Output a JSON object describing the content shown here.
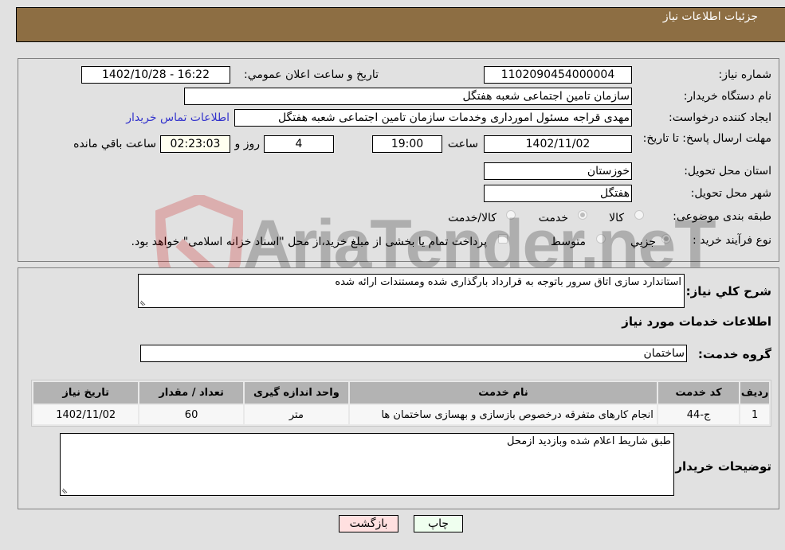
{
  "header": {
    "title": "جزئیات اطلاعات نیاز"
  },
  "form": {
    "need_number": {
      "label": "شماره نیاز:",
      "value": "1102090454000004"
    },
    "announce_datetime": {
      "label": "تاریخ و ساعت اعلان عمومي:",
      "value": "1402/10/28 - 16:22"
    },
    "buyer_org": {
      "label": "نام دستگاه خریدار:",
      "value": "سازمان تامین اجتماعی شعبه هفتگل"
    },
    "creator": {
      "label": "ایجاد کننده درخواست:",
      "value": "مهدی قراجه مسئول امورداری وخدمات سازمان تامین اجتماعی شعبه هفتگل"
    },
    "contact_link": "اطلاعات تماس خریدار",
    "deadline": {
      "label": "مهلت ارسال پاسخ: تا تاریخ:",
      "date": "1402/11/02",
      "time_label": "ساعت",
      "time": "19:00",
      "days": "4",
      "days_label": "روز و",
      "remaining": "02:23:03",
      "remaining_label": "ساعت باقي مانده"
    },
    "province": {
      "label": "استان محل تحویل:",
      "value": "خوزستان"
    },
    "city": {
      "label": "شهر محل تحویل:",
      "value": "هفتگل"
    },
    "category": {
      "label": "طبقه بندی موضوعی:",
      "options": [
        {
          "label": "کالا",
          "selected": false
        },
        {
          "label": "خدمت",
          "selected": true
        },
        {
          "label": "کالا/خدمت",
          "selected": false
        }
      ]
    },
    "purchase_type": {
      "label": "نوع فرآیند خرید :",
      "options": [
        {
          "label": "جزيي",
          "selected": true
        },
        {
          "label": "متوسط",
          "selected": false
        }
      ],
      "treasury_note": "پرداخت تمام یا بخشی از مبلغ خرید،از محل \"اسناد خزانه اسلامی\" خواهد بود.",
      "treasury_checked": false
    }
  },
  "description": {
    "label": "شرح کلي نیاز:",
    "value": "استاندارد سازی اتاق سرور باتوجه به قرارداد بارگذاری شده ومستندات ارائه شده"
  },
  "services": {
    "section_title": "اطلاعات خدمات مورد نیاز",
    "group_label": "گروه خدمت:",
    "group_value": "ساختمان",
    "columns": [
      "ردیف",
      "کد خدمت",
      "نام خدمت",
      "واحد اندازه گیری",
      "تعداد / مقدار",
      "تاریخ نیاز"
    ],
    "rows": [
      [
        "1",
        "ج-44",
        "انجام کارهای متفرقه درخصوص بازسازی و بهسازی ساختمان ها",
        "متر",
        "60",
        "1402/11/02"
      ]
    ]
  },
  "buyer_notes": {
    "label": "توضیحات خریدار:",
    "value": "طبق شاریط اعلام شده وبازدید ازمحل"
  },
  "buttons": {
    "print": "چاپ",
    "back": "بازگشت"
  },
  "colors": {
    "header": "#8d6e43",
    "print_bg": "#efffef",
    "back_bg": "#ffe0e0",
    "link": "#3333cc"
  },
  "watermark": "AriaTender.neT"
}
